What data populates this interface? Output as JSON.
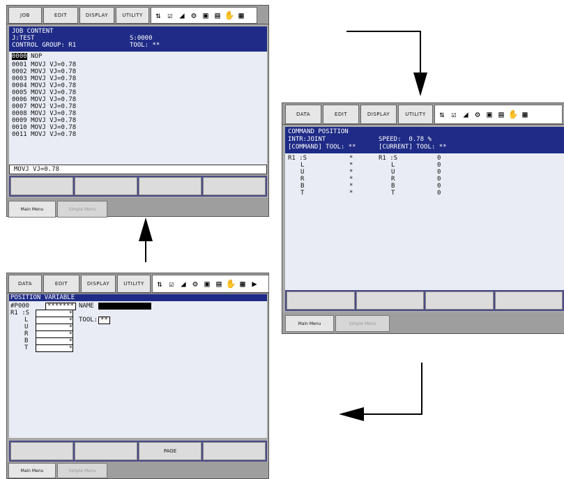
{
  "job_panel": {
    "menu": {
      "job": "JOB",
      "edit": "EDIT",
      "display": "DISPLAY",
      "utility": "UTILITY"
    },
    "header": {
      "title": "JOB CONTENT",
      "job": "J:TEST",
      "step": "S:0000",
      "group": "CONTROL GROUP: R1",
      "tool": "TOOL: **"
    },
    "lines": [
      {
        "num": "0000",
        "text": "NOP"
      },
      {
        "num": "0001",
        "text": "MOVJ VJ=0.78"
      },
      {
        "num": "0002",
        "text": "MOVJ VJ=0.78"
      },
      {
        "num": "0003",
        "text": "MOVJ VJ=0.78"
      },
      {
        "num": "0004",
        "text": "MOVJ VJ=0.78"
      },
      {
        "num": "0005",
        "text": "MOVJ VJ=0.78"
      },
      {
        "num": "0006",
        "text": "MOVJ VJ=0.78"
      },
      {
        "num": "0007",
        "text": "MOVJ VJ=0.78"
      },
      {
        "num": "0008",
        "text": "MOVJ VJ=0.78"
      },
      {
        "num": "0009",
        "text": "MOVJ VJ=0.78"
      },
      {
        "num": "0010",
        "text": "MOVJ VJ=0.78"
      },
      {
        "num": "0011",
        "text": "MOVJ VJ=0.78"
      }
    ],
    "input": "MOVJ VJ=0.78",
    "main_menu": "Main Menu",
    "simple_menu": "Simple Menu"
  },
  "cmd_panel": {
    "menu": {
      "data": "DATA",
      "edit": "EDIT",
      "display": "DISPLAY",
      "utility": "UTILITY"
    },
    "header": {
      "title": "COMMAND POSITION",
      "intr": "INTR:JOINT",
      "speed": "SPEED:  0.78 %",
      "command_tool": "[COMMAND] TOOL: **",
      "current_tool": "[CURRENT] TOOL: **"
    },
    "rows": [
      {
        "left": "R1 :S",
        "cmd": "*",
        "cur_label": "R1 :S",
        "cur": "0"
      },
      {
        "left": "L",
        "cmd": "*",
        "cur_label": "L",
        "cur": "0"
      },
      {
        "left": "U",
        "cmd": "*",
        "cur_label": "U",
        "cur": "0"
      },
      {
        "left": "R",
        "cmd": "*",
        "cur_label": "R",
        "cur": "0"
      },
      {
        "left": "B",
        "cmd": "*",
        "cur_label": "B",
        "cur": "0"
      },
      {
        "left": "T",
        "cmd": "*",
        "cur_label": "T",
        "cur": "0"
      }
    ],
    "main_menu": "Main Menu",
    "simple_menu": "Simple Menu"
  },
  "pos_panel": {
    "menu": {
      "data": "DATA",
      "edit": "EDIT",
      "display": "DISPLAY",
      "utility": "UTILITY"
    },
    "header": {
      "title": "POSITION VARIABLE"
    },
    "var": "#P000",
    "var_value": "*******",
    "name_label": "NAME",
    "axes": [
      {
        "label": "R1 :S",
        "value": "*"
      },
      {
        "label": "L",
        "value": "*"
      },
      {
        "label": "U",
        "value": "*"
      },
      {
        "label": "R",
        "value": "*"
      },
      {
        "label": "B",
        "value": "*"
      },
      {
        "label": "T",
        "value": "*"
      }
    ],
    "tool_label": "TOOL:",
    "tool_value": "**",
    "page_key": "PAGE",
    "main_menu": "Main Menu",
    "simple_menu": "Simple Menu"
  }
}
